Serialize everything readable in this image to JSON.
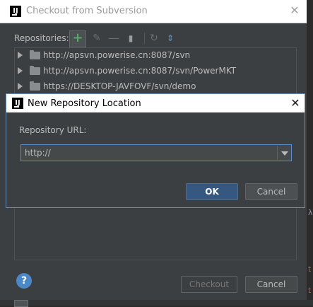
{
  "background_dialog": {
    "title": "Checkout from Subversion",
    "repositories_label": "Repositories:",
    "repositories": [
      "http://apsvn.powerise.cn:8087/svn",
      "http://apsvn.powerise.cn:8087/svn/PowerMKT",
      "https://DESKTOP-JAVFOVF/svn/demo"
    ],
    "checkout_label": "Checkout",
    "cancel_label": "Cancel",
    "help_label": "?"
  },
  "foreground_dialog": {
    "title": "New Repository Location",
    "url_label": "Repository URL:",
    "url_value": "http://",
    "ok_label": "OK",
    "cancel_label": "Cancel"
  },
  "colors": {
    "panel_bg": "#3c3f41",
    "add_green": "#59a869",
    "ok_blue": "#365880",
    "focus_border": "#5a8fcf"
  }
}
